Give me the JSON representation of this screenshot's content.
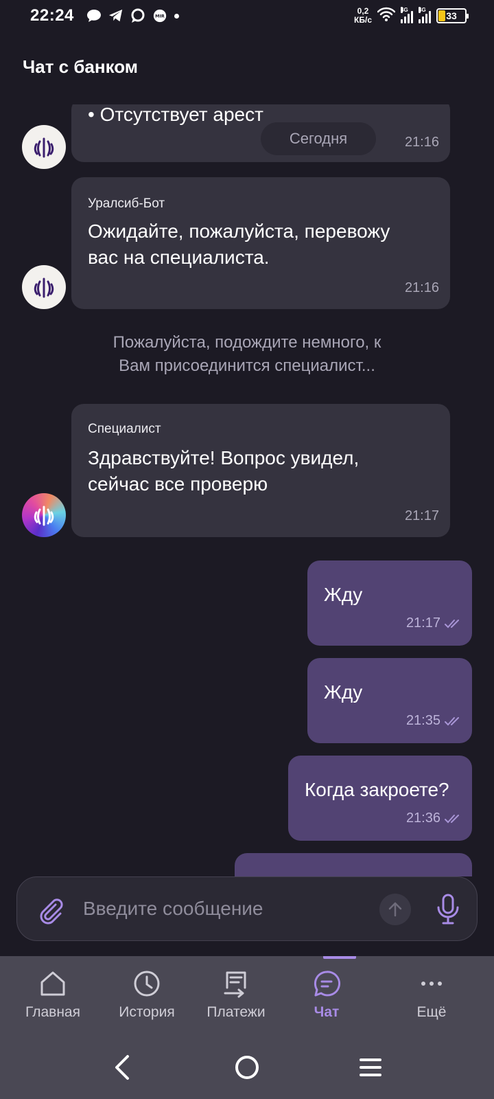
{
  "status_bar": {
    "time": "22:24",
    "net_speed_value": "0,2",
    "net_speed_unit": "КБ/с",
    "sig1_label": "4G",
    "sig2_label": "4G",
    "battery_level": "33",
    "notification_icons": [
      "chat-bubble-icon",
      "telegram-icon",
      "message-icon",
      "mir-icon"
    ]
  },
  "header": {
    "title": "Чат с банком"
  },
  "chat": {
    "date_separator": "Сегодня",
    "messages_in": [
      {
        "sender": "",
        "text": "• Отсутствует арест",
        "time": "21:16"
      },
      {
        "sender": "Уралсиб-Бот",
        "text_lines": [
          "Ожидайте, пожалуйста, перевожу",
          "вас на специалиста."
        ],
        "time": "21:16"
      },
      {
        "sender": "Специалист",
        "text_lines": [
          "Здравствуйте! Вопрос увидел,",
          "сейчас все проверю"
        ],
        "time": "21:17"
      }
    ],
    "system_note_lines": [
      "Пожалуйста, подождите немного, к",
      "Вам присоединится специалист..."
    ],
    "messages_out": [
      {
        "text": "Жду",
        "time": "21:17"
      },
      {
        "text": "Жду",
        "time": "21:35"
      },
      {
        "text": "Когда закроете?",
        "time": "21:36"
      }
    ]
  },
  "composer": {
    "placeholder": "Введите сообщение",
    "value": ""
  },
  "bottom_nav": {
    "items": [
      {
        "label": "Главная",
        "icon": "home-icon"
      },
      {
        "label": "История",
        "icon": "clock-icon"
      },
      {
        "label": "Платежи",
        "icon": "payments-icon"
      },
      {
        "label": "Чат",
        "icon": "chat-icon",
        "active": true
      },
      {
        "label": "Ещё",
        "icon": "more-icon"
      }
    ]
  },
  "colors": {
    "background": "#1c1a24",
    "bubble_in": "#35333f",
    "bubble_out": "#524373",
    "accent": "#a88be6",
    "nav_bg": "#4a4854"
  }
}
